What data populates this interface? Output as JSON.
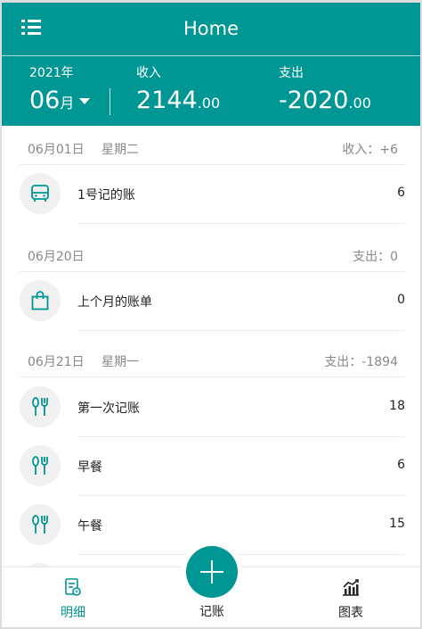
{
  "header": {
    "title": "Home"
  },
  "summary": {
    "year_label": "2021年",
    "month_value": "06",
    "month_unit": "月",
    "income_label": "收入",
    "income_main": "2144",
    "income_cents": ".00",
    "expense_label": "支出",
    "expense_main": "-2020",
    "expense_cents": ".00"
  },
  "days": [
    {
      "date": "06月01日",
      "weekday": "星期二",
      "total": "收入：+6"
    },
    {
      "date": "06月20日",
      "weekday": "",
      "total": "支出：0"
    },
    {
      "date": "06月21日",
      "weekday": "星期一",
      "total": "支出：-1894"
    }
  ],
  "entries": [
    {
      "name": "1号记的账",
      "value": "6",
      "icon": "bus-icon"
    },
    {
      "name": "上个月的账单",
      "value": "0",
      "icon": "shopping-bag-icon"
    },
    {
      "name": "第一次记账",
      "value": "18",
      "icon": "dining-icon"
    },
    {
      "name": "早餐",
      "value": "6",
      "icon": "dining-icon"
    },
    {
      "name": "午餐",
      "value": "15",
      "icon": "dining-icon"
    }
  ],
  "tabs": {
    "detail": "明细",
    "add": "记账",
    "chart": "图表"
  },
  "colors": {
    "primary": "#009693",
    "muted_text": "#888888",
    "divider": "#ececec"
  }
}
